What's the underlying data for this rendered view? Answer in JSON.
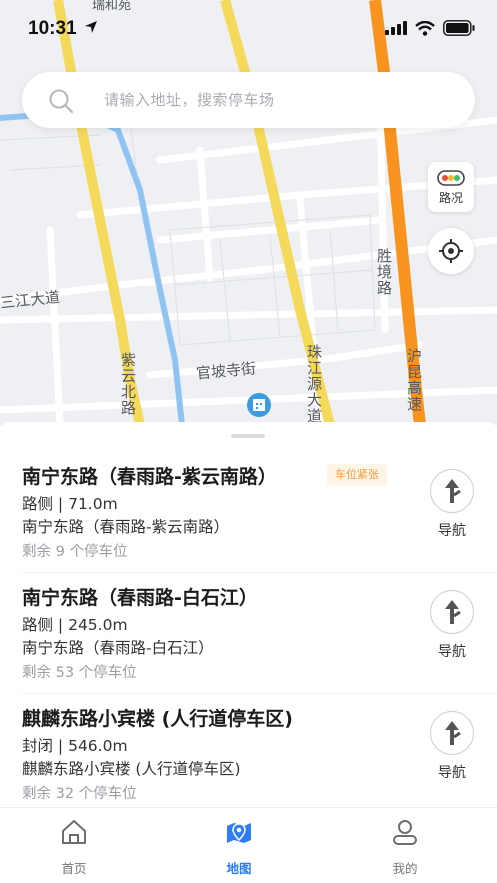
{
  "status": {
    "time": "10:31"
  },
  "search": {
    "placeholder": "请输入地址，搜索停车场"
  },
  "map": {
    "traffic_label": "路况",
    "labels": {
      "sanjiang": "三江大道",
      "guanpo": "官坡寺街",
      "ziyunbei": "紫云北路",
      "zhujiangyuan": "珠江源大道",
      "shengjing": "胜境路",
      "hukun": "沪昆高速",
      "top": "瑞和苑"
    },
    "colors": {
      "arterial": "#f4d95a",
      "expressway": "#f7931e",
      "river": "#8fc4f2",
      "poi": "#3a9be0"
    }
  },
  "lots": [
    {
      "title": "南宁东路（春雨路-紫云南路）",
      "tag": "车位紧张",
      "meta": "路侧 | 71.0m",
      "address": "南宁东路（春雨路-紫云南路）",
      "remaining": "剩余 9 个停车位",
      "nav_label": "导航"
    },
    {
      "title": "南宁东路（春雨路-白石江）",
      "meta": "路侧 | 245.0m",
      "address": "南宁东路（春雨路-白石江）",
      "remaining": "剩余 53 个停车位",
      "nav_label": "导航"
    },
    {
      "title": "麒麟东路小宾楼 (人行道停车区)",
      "meta": "封闭 | 546.0m",
      "address": "麒麟东路小宾楼 (人行道停车区)",
      "remaining": "剩余 32 个停车位",
      "nav_label": "导航"
    }
  ],
  "tabs": [
    {
      "label": "首页",
      "icon": "home-icon"
    },
    {
      "label": "地图",
      "icon": "map-pin-icon",
      "active": true
    },
    {
      "label": "我的",
      "icon": "user-icon"
    }
  ],
  "theme": {
    "accent": "#2e7cf6"
  }
}
